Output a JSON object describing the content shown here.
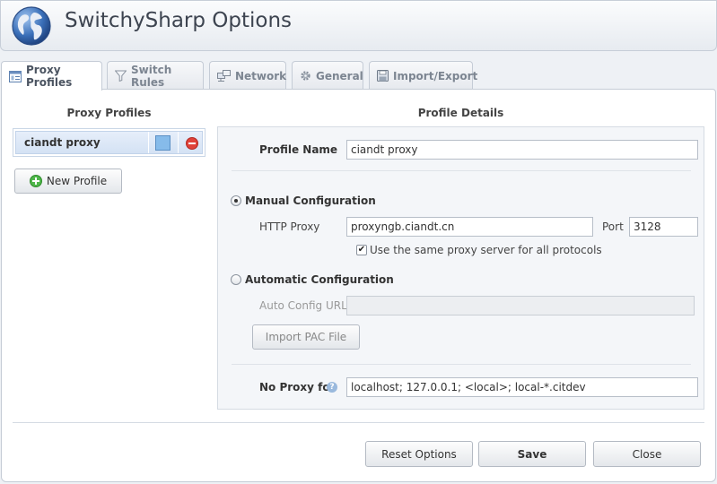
{
  "app": {
    "title": "SwitchySharp Options"
  },
  "tabs": [
    {
      "label": "Proxy Profiles",
      "icon": "profiles-icon",
      "active": true
    },
    {
      "label": "Switch Rules",
      "icon": "filter-icon",
      "active": false
    },
    {
      "label": "Network",
      "icon": "network-icon",
      "active": false
    },
    {
      "label": "General",
      "icon": "gear-icon",
      "active": false
    },
    {
      "label": "Import/Export",
      "icon": "disk-icon",
      "active": false
    }
  ],
  "profiles_panel": {
    "heading": "Proxy Profiles",
    "items": [
      {
        "name": "ciandt proxy",
        "color": "#86bbea"
      }
    ],
    "new_profile_label": "New Profile"
  },
  "details": {
    "heading": "Profile Details",
    "profile_name_label": "Profile Name",
    "profile_name_value": "ciandt proxy",
    "manual_config_label": "Manual Configuration",
    "manual_selected": true,
    "http_proxy_label": "HTTP Proxy",
    "http_proxy_value": "proxyngb.ciandt.cn",
    "port_label": "Port",
    "port_value": "3128",
    "same_proxy_label": "Use the same proxy server for all protocols",
    "same_proxy_checked": true,
    "auto_config_label": "Automatic Configuration",
    "auto_config_url_label": "Auto Config URL",
    "auto_config_url_value": "",
    "import_pac_label": "Import PAC File",
    "no_proxy_label": "No Proxy for",
    "no_proxy_value": "localhost; 127.0.0.1; <local>; local-*.citdev"
  },
  "footer": {
    "reset_label": "Reset Options",
    "save_label": "Save",
    "close_label": "Close"
  }
}
